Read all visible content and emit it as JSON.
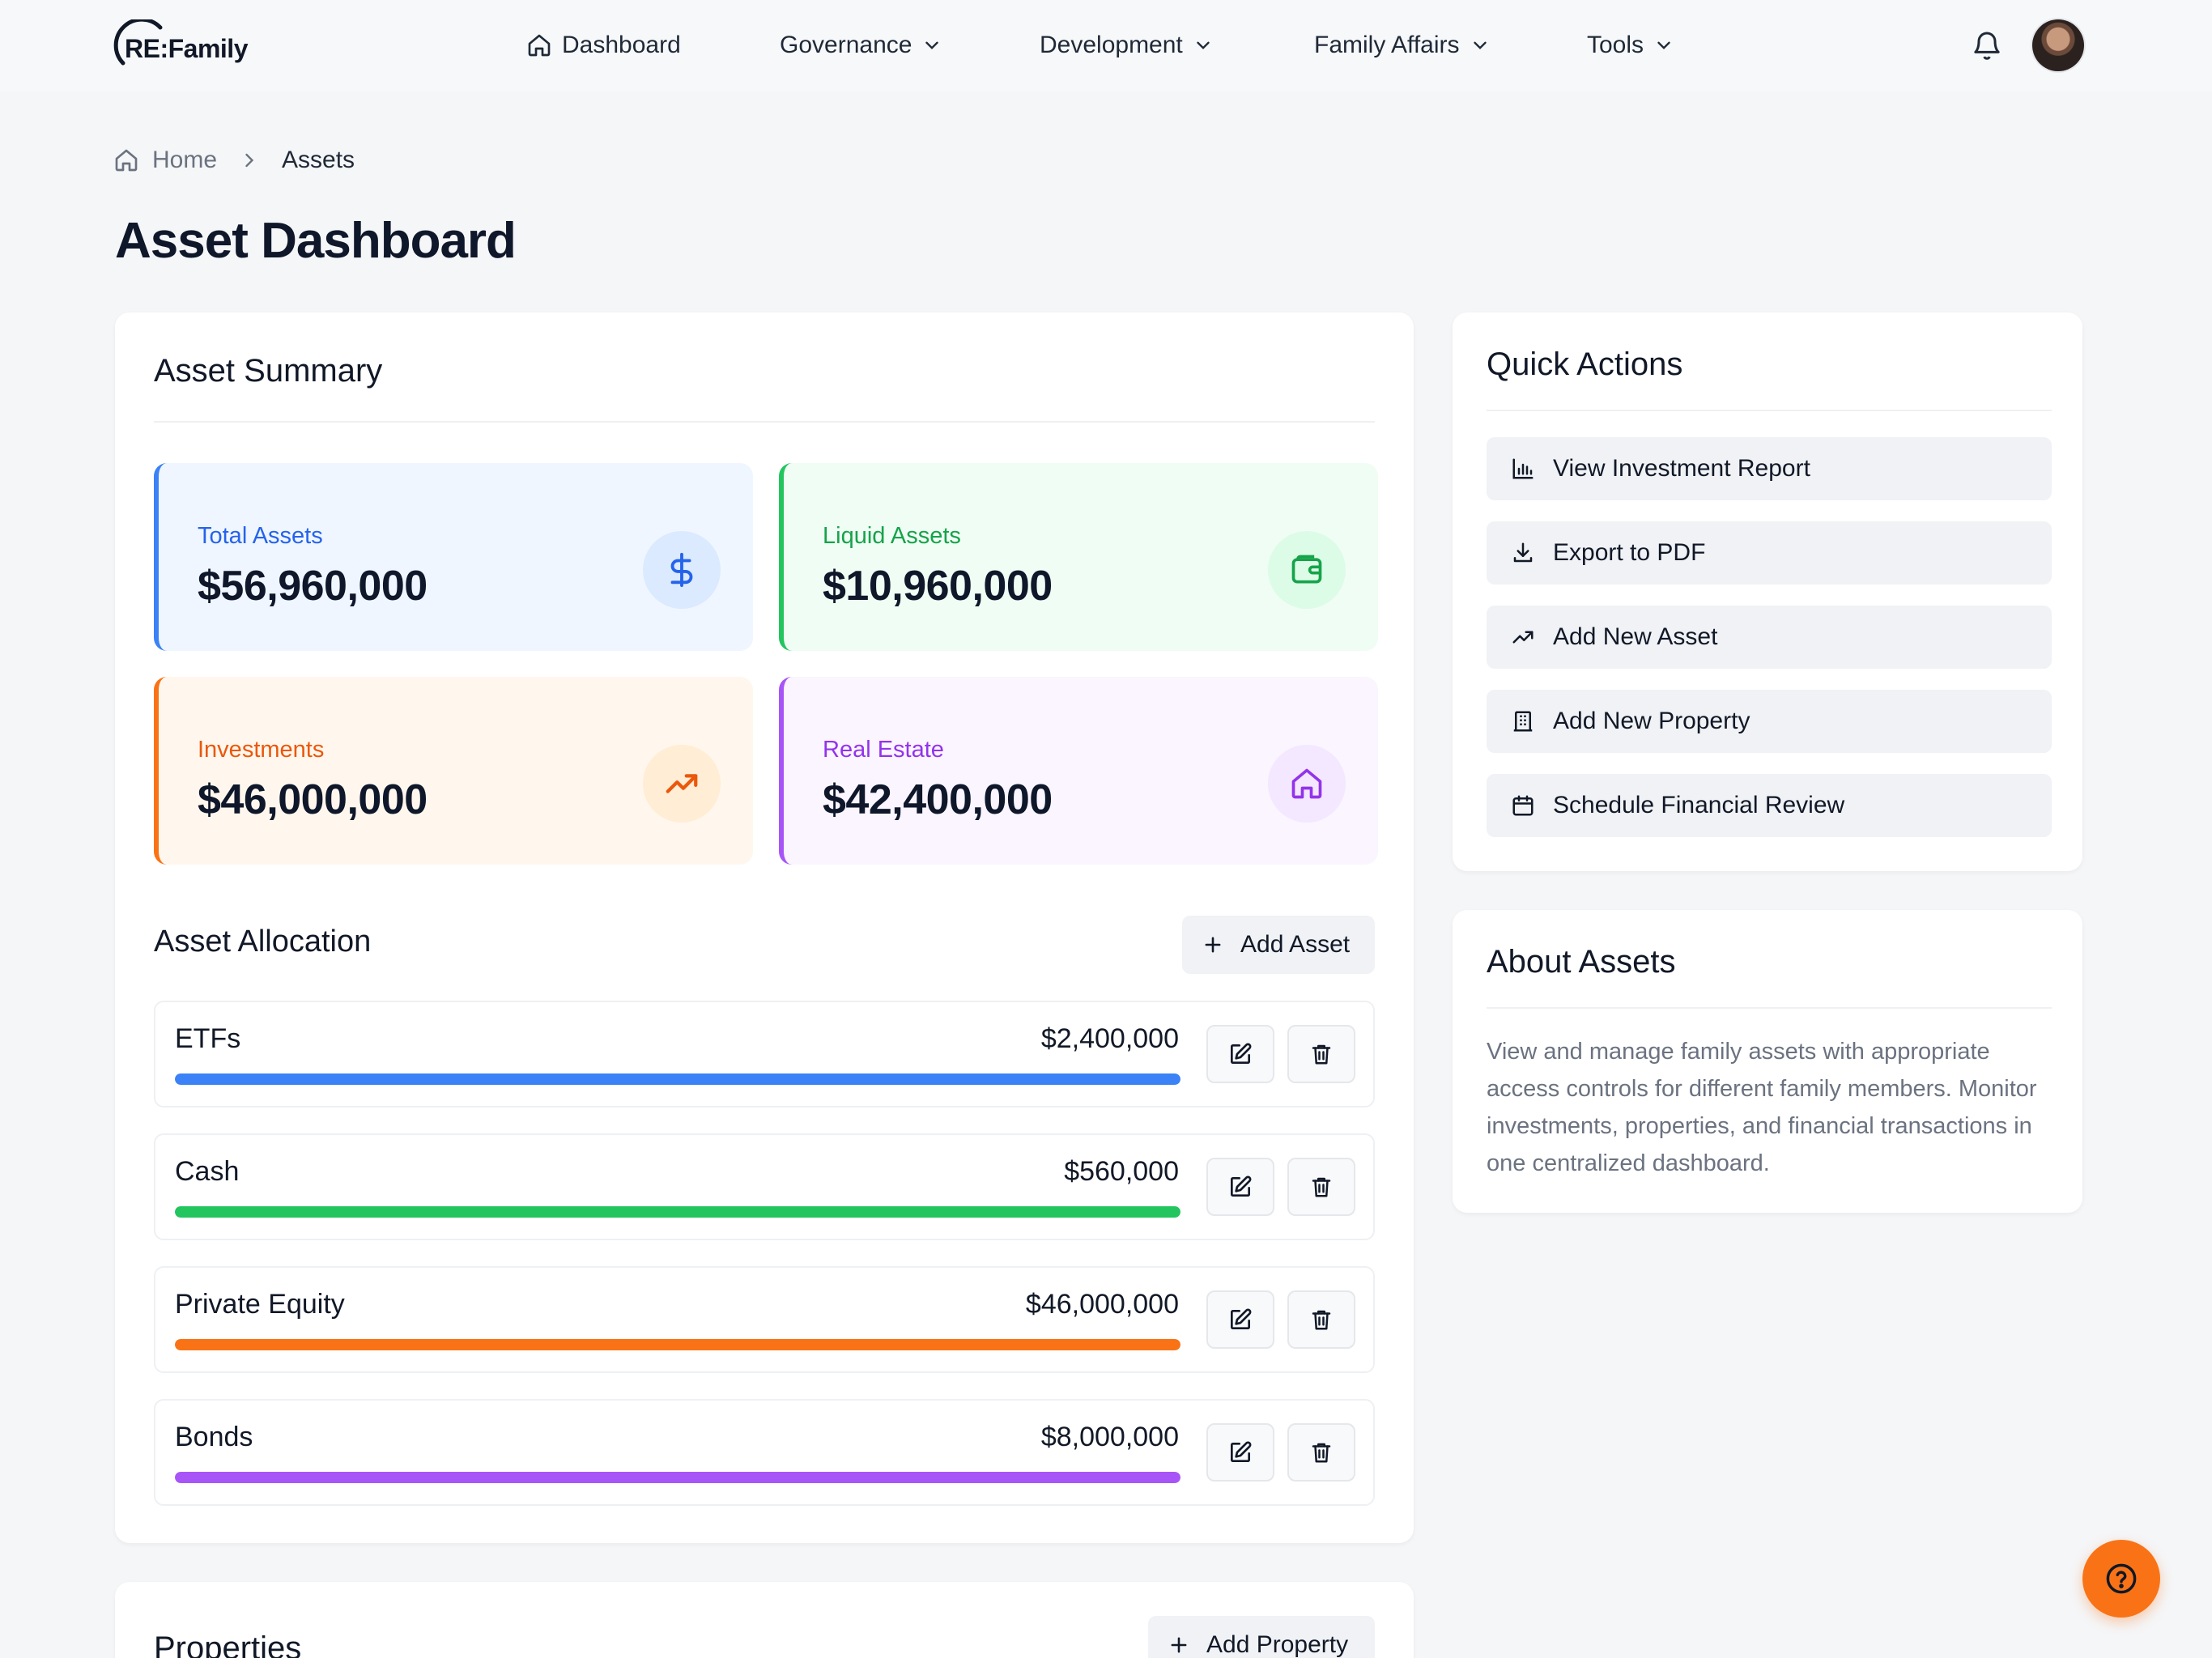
{
  "brand": {
    "logo_text": "RE:Family"
  },
  "nav": {
    "items": [
      {
        "label": "Dashboard",
        "icon": "home-icon"
      },
      {
        "label": "Governance",
        "icon": "chevron-down-icon"
      },
      {
        "label": "Development",
        "icon": "chevron-down-icon"
      },
      {
        "label": "Family Affairs",
        "icon": "chevron-down-icon"
      },
      {
        "label": "Tools",
        "icon": "chevron-down-icon"
      }
    ]
  },
  "breadcrumb": {
    "home": "Home",
    "current": "Assets"
  },
  "page": {
    "title": "Asset Dashboard"
  },
  "summary": {
    "title": "Asset Summary",
    "stats": [
      {
        "label": "Total Assets",
        "value": "$56,960,000",
        "icon": "dollar-icon",
        "accent": "#3b82f6",
        "label_color": "#2563eb",
        "bg": "#eff6ff",
        "icon_bg": "#dbeafe"
      },
      {
        "label": "Liquid Assets",
        "value": "$10,960,000",
        "icon": "wallet-icon",
        "accent": "#22c55e",
        "label_color": "#16a34a",
        "bg": "#f0fdf4",
        "icon_bg": "#dcfce7"
      },
      {
        "label": "Investments",
        "value": "$46,000,000",
        "icon": "trending-up-icon",
        "accent": "#f97316",
        "label_color": "#ea580c",
        "bg": "#fff7ed",
        "icon_bg": "#ffedd5"
      },
      {
        "label": "Real Estate",
        "value": "$42,400,000",
        "icon": "home-icon",
        "accent": "#a855f7",
        "label_color": "#9333ea",
        "bg": "#faf5ff",
        "icon_bg": "#f3e8ff"
      }
    ]
  },
  "allocation": {
    "title": "Asset Allocation",
    "add_label": "Add Asset",
    "rows": [
      {
        "name": "ETFs",
        "value": "$2,400,000",
        "color": "#3b82f6",
        "fill": 1.0
      },
      {
        "name": "Cash",
        "value": "$560,000",
        "color": "#22c55e",
        "fill": 1.0
      },
      {
        "name": "Private Equity",
        "value": "$46,000,000",
        "color": "#f97316",
        "fill": 1.0
      },
      {
        "name": "Bonds",
        "value": "$8,000,000",
        "color": "#a855f7",
        "fill": 1.0
      }
    ]
  },
  "properties": {
    "title": "Properties",
    "add_label": "Add Property"
  },
  "quick_actions": {
    "title": "Quick Actions",
    "items": [
      {
        "label": "View Investment Report",
        "icon": "bar-chart-icon"
      },
      {
        "label": "Export to PDF",
        "icon": "download-icon"
      },
      {
        "label": "Add New Asset",
        "icon": "trending-up-icon"
      },
      {
        "label": "Add New Property",
        "icon": "building-icon"
      },
      {
        "label": "Schedule Financial Review",
        "icon": "calendar-icon"
      }
    ]
  },
  "about": {
    "title": "About Assets",
    "text": "View and manage family assets with appropriate access controls for different family members. Monitor investments, properties, and financial transactions in one centralized dashboard."
  },
  "help": {
    "icon": "help-circle-icon"
  }
}
